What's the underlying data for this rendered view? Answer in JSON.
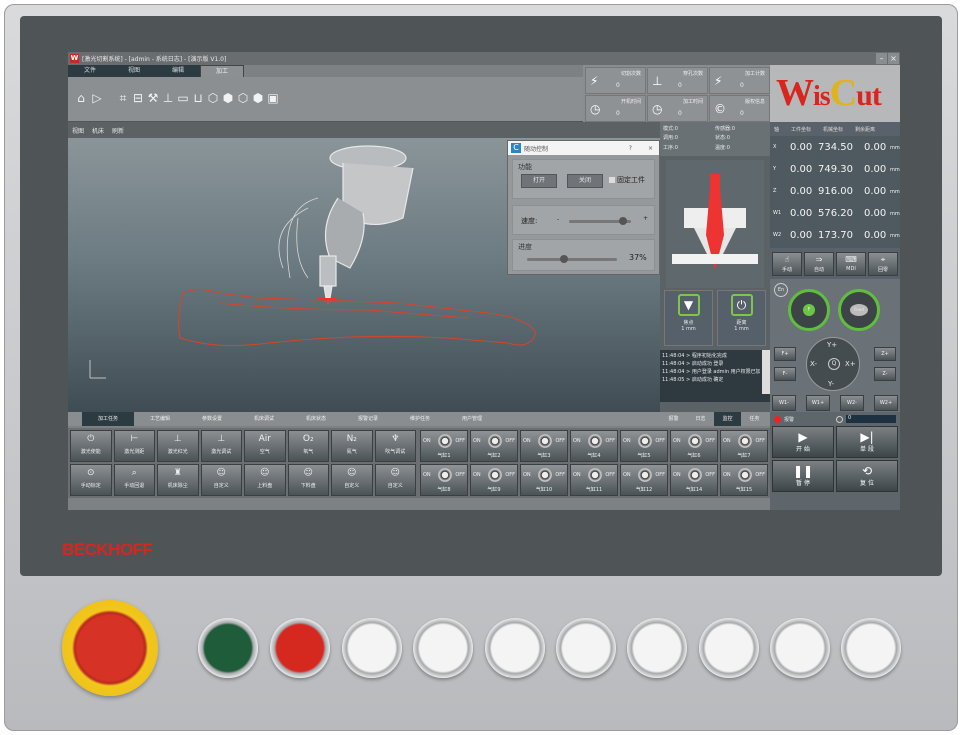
{
  "window": {
    "title": "[激光切割系统] - [admin - 系统日志] - [演示版 V1.0]",
    "app_icon": "W"
  },
  "menu_tabs": [
    {
      "label": "文件"
    },
    {
      "label": "视图"
    },
    {
      "label": "编辑"
    },
    {
      "label": "加工",
      "active": true
    }
  ],
  "ribbon_icons": [
    "home-icon",
    "play-icon",
    "import-icon",
    "layer-icon",
    "part-icon",
    "tool-icon",
    "monitor-icon",
    "station-icon",
    "cube-icon",
    "box-icon",
    "box2-icon",
    "box3-icon",
    "image-icon"
  ],
  "info_boxes": [
    {
      "label": "切割次数",
      "value": "0",
      "icon": "bolt-icon",
      "glyph": "⚡"
    },
    {
      "label": "穿孔次数",
      "value": "0",
      "icon": "pierce-icon",
      "glyph": "⊥"
    },
    {
      "label": "加工计数",
      "value": "0",
      "icon": "bolt-icon",
      "glyph": "⚡"
    },
    {
      "label": "开机时间",
      "value": "0",
      "icon": "clock-icon",
      "glyph": "◷"
    },
    {
      "label": "加工时间",
      "value": "0",
      "icon": "clock-icon",
      "glyph": "◷"
    },
    {
      "label": "版权信息",
      "value": "0",
      "icon": "copyright-icon",
      "glyph": "©"
    }
  ],
  "brand": {
    "logo": "WisCut",
    "color": "#d8251e"
  },
  "view_toolbar": [
    "视图",
    "机床",
    "刷新"
  ],
  "dialog": {
    "title": "随动控制",
    "help": "?",
    "close": "×",
    "function_label": "功能",
    "btn_open": "打开",
    "btn_close": "关闭",
    "checkbox_label": "固定工件",
    "speed_label": "速度:",
    "minus": "-",
    "plus": "+",
    "progress_label": "进度",
    "progress_value": "37%",
    "speed_fraction": 0.8,
    "progress_fraction": 0.37
  },
  "status_info": [
    {
      "l": "模式:",
      "v": "0"
    },
    {
      "l": "传感器:",
      "v": "0"
    },
    {
      "l": "调用:",
      "v": "0"
    },
    {
      "l": "状态:",
      "v": "0"
    },
    {
      "l": "工序:",
      "v": "0"
    },
    {
      "l": "温度:",
      "v": "0"
    }
  ],
  "nozzle_buttons": [
    {
      "label": "焦点",
      "value": "1 mm"
    },
    {
      "label": "距离",
      "value": "1 mm"
    }
  ],
  "log": [
    "11:48:04 > 程序初始化完成",
    "11:48:04 > 启动成功 登录",
    "11:48:04 > 用户登录 admin 用户权限已加载",
    "11:48:05 > 启动成功 确定"
  ],
  "mid_tabs": [
    {
      "label": "报警"
    },
    {
      "label": "日志"
    },
    {
      "label": "监控",
      "active": true
    },
    {
      "label": "任务"
    }
  ],
  "coord_header": {
    "axis": "轴",
    "work": "工件坐标",
    "machine": "机械坐标",
    "remain": "剩余距离"
  },
  "coords": [
    {
      "axis": "X",
      "work": "0.00",
      "machine": "734.50",
      "remain": "0.00",
      "unit": "mm"
    },
    {
      "axis": "Y",
      "work": "0.00",
      "machine": "749.30",
      "remain": "0.00",
      "unit": "mm"
    },
    {
      "axis": "Z",
      "work": "0.00",
      "machine": "916.00",
      "remain": "0.00",
      "unit": "mm"
    },
    {
      "axis": "W1",
      "work": "0.00",
      "machine": "576.20",
      "remain": "0.00",
      "unit": "mm"
    },
    {
      "axis": "W2",
      "work": "0.00",
      "machine": "173.70",
      "remain": "0.00",
      "unit": "mm"
    }
  ],
  "modes": [
    {
      "label": "手动",
      "glyph": "☝"
    },
    {
      "label": "自动",
      "glyph": "⇒"
    },
    {
      "label": "MDI",
      "glyph": "⌨"
    },
    {
      "label": "回零",
      "glyph": "⌖"
    }
  ],
  "jog": {
    "enable": "En",
    "feed_label": "F",
    "speed_label": "Feed",
    "up": "Y+",
    "down": "Y-",
    "left": "X-",
    "right": "X+",
    "center": "Q",
    "side": [
      "Z+",
      "Z-",
      "F+",
      "F-"
    ],
    "w": [
      "W1-",
      "W1+",
      "W2-",
      "W2+"
    ]
  },
  "status_row": {
    "alarm_label": "报警",
    "progress": "0"
  },
  "run_buttons": [
    {
      "label": "开 始",
      "glyph": "▶"
    },
    {
      "label": "单 段",
      "glyph": "▶|"
    },
    {
      "label": "暂 停",
      "glyph": "❚❚"
    },
    {
      "label": "复 位",
      "glyph": "⟲"
    }
  ],
  "bottom_tabs": [
    {
      "label": "加工任务",
      "active": true
    },
    {
      "label": "工艺编辑"
    },
    {
      "label": "参数设置"
    },
    {
      "label": "机床调试"
    },
    {
      "label": "机床状态"
    },
    {
      "label": "报警记录"
    },
    {
      "label": "维护任务"
    },
    {
      "label": "用户管理"
    }
  ],
  "func_buttons": [
    {
      "label": "激光使能",
      "glyph": "⏻"
    },
    {
      "label": "激光测距",
      "glyph": "⊢"
    },
    {
      "label": "激光红光",
      "glyph": "⊥"
    },
    {
      "label": "激光调试",
      "glyph": "⊥"
    },
    {
      "label": "空气",
      "glyph": "Air"
    },
    {
      "label": "氧气",
      "glyph": "O₂"
    },
    {
      "label": "氮气",
      "glyph": "N₂"
    },
    {
      "label": "吹气调试",
      "glyph": "♆"
    },
    {
      "label": "手动标定",
      "glyph": "⊙"
    },
    {
      "label": "手动回退",
      "glyph": "⌕"
    },
    {
      "label": "机床除尘",
      "glyph": "♜"
    },
    {
      "label": "自定义",
      "glyph": "☺"
    },
    {
      "label": "上料盘",
      "glyph": "☺"
    },
    {
      "label": "下料盘",
      "glyph": "☺"
    },
    {
      "label": "自定义",
      "glyph": "☺"
    },
    {
      "label": "自定义",
      "glyph": "☺"
    }
  ],
  "valves": {
    "on": "ON",
    "off": "OFF",
    "names": [
      "气缸1",
      "气缸2",
      "气缸3",
      "气缸4",
      "气缸5",
      "气缸6",
      "气缸7",
      "气缸8",
      "气缸9",
      "气缸10",
      "气缸11",
      "气缸12",
      "气缸14",
      "气缸15"
    ]
  },
  "hardware": {
    "brand": "BECKHOFF",
    "brand_color": "#d8251e",
    "buttons": [
      "#1f5c3a",
      "#d5281f",
      "#f2f2f2",
      "#f2f2f2",
      "#f2f2f2",
      "#f2f2f2",
      "#f2f2f2",
      "#f2f2f2",
      "#f2f2f2",
      "#f2f2f2"
    ]
  }
}
